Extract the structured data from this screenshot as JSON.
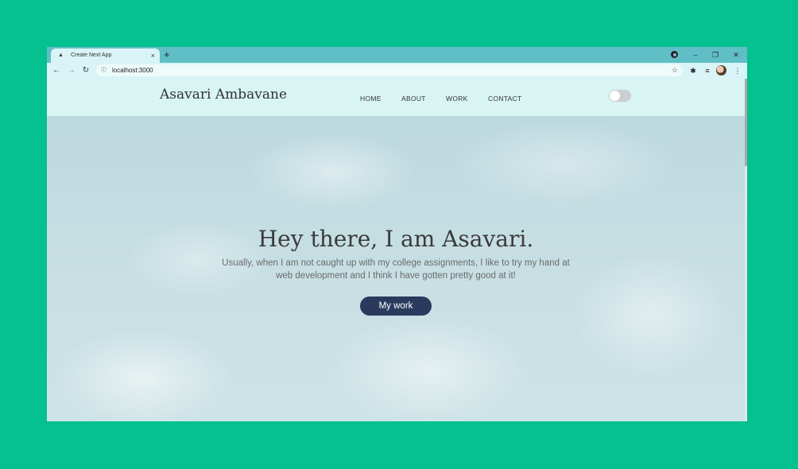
{
  "browser": {
    "tab_title": "Create Next App",
    "tab_favicon": "▲",
    "tab_close": "×",
    "new_tab": "+",
    "url": "localhost:3000",
    "window_controls": {
      "minimize": "–",
      "restore": "❐",
      "close": "✕"
    },
    "icons": {
      "back": "←",
      "forward": "→",
      "reload": "↻",
      "info": "ⓘ",
      "star": "☆",
      "extensions": "✱",
      "reading_list": "≡",
      "menu": "⋮"
    }
  },
  "site": {
    "brand": "Asavari Ambavane",
    "nav": [
      "HOME",
      "ABOUT",
      "WORK",
      "CONTACT"
    ],
    "theme_toggle_on": false
  },
  "hero": {
    "title": "Hey there, I am Asavari.",
    "subtitle": "Usually, when I am not caught up with my college assignments, I like to try my hand at web development and I think I have gotten pretty good at it!",
    "button": "My work"
  },
  "colors": {
    "outer_background": "#05c08f",
    "tab_strip": "#5fbec6",
    "navbar": "#d8f4f3",
    "button": "#2a3a5f"
  }
}
